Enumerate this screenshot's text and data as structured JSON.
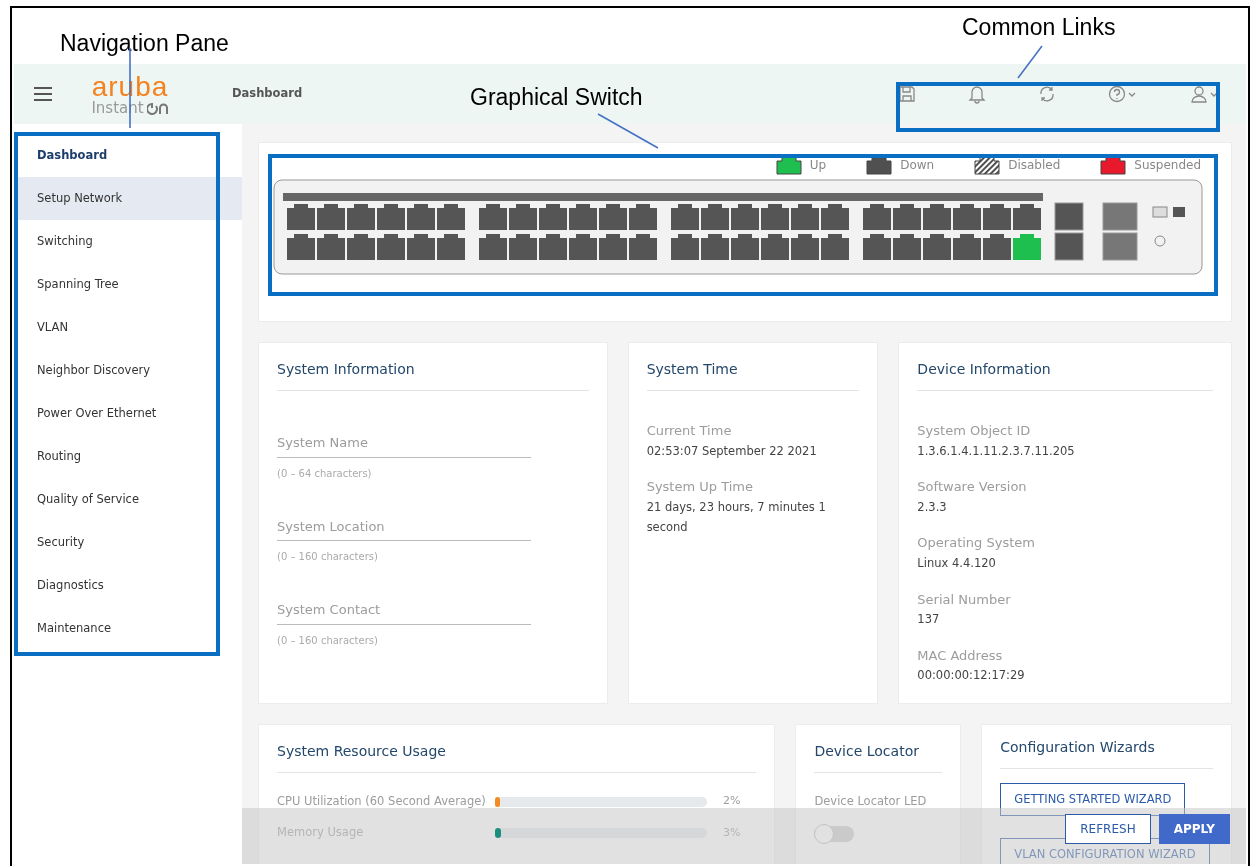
{
  "annotations": [
    {
      "label": "Navigation Pane"
    },
    {
      "label": "Graphical Switch"
    },
    {
      "label": "Common Links"
    }
  ],
  "header": {
    "logo": "aruba",
    "logo_sub": "Instant",
    "page_title": "Dashboard"
  },
  "sidebar": {
    "items": [
      {
        "label": "Dashboard",
        "selected": true,
        "hovered": false
      },
      {
        "label": "Setup Network",
        "selected": false,
        "hovered": true
      },
      {
        "label": "Switching",
        "selected": false,
        "hovered": false
      },
      {
        "label": "Spanning Tree",
        "selected": false,
        "hovered": false
      },
      {
        "label": "VLAN",
        "selected": false,
        "hovered": false
      },
      {
        "label": "Neighbor Discovery",
        "selected": false,
        "hovered": false
      },
      {
        "label": "Power Over Ethernet",
        "selected": false,
        "hovered": false
      },
      {
        "label": "Routing",
        "selected": false,
        "hovered": false
      },
      {
        "label": "Quality of Service",
        "selected": false,
        "hovered": false
      },
      {
        "label": "Security",
        "selected": false,
        "hovered": false
      },
      {
        "label": "Diagnostics",
        "selected": false,
        "hovered": false
      },
      {
        "label": "Maintenance",
        "selected": false,
        "hovered": false
      }
    ]
  },
  "switch": {
    "legend": [
      {
        "label": "Up",
        "kind": "solid",
        "color": "#1fbf4f"
      },
      {
        "label": "Down",
        "kind": "solid",
        "color": "#505050"
      },
      {
        "label": "Disabled",
        "kind": "hatched",
        "color": "#505050"
      },
      {
        "label": "Suspended",
        "kind": "solid",
        "color": "#e8192c"
      }
    ],
    "ports": [
      {
        "up": false
      },
      {
        "up": false
      },
      {
        "up": false
      },
      {
        "up": false
      },
      {
        "up": false
      },
      {
        "up": false
      },
      {
        "up": false
      },
      {
        "up": false
      },
      {
        "up": false
      },
      {
        "up": false
      },
      {
        "up": false
      },
      {
        "up": false
      },
      {
        "up": false
      },
      {
        "up": false
      },
      {
        "up": false
      },
      {
        "up": false
      },
      {
        "up": false
      },
      {
        "up": false
      },
      {
        "up": false
      },
      {
        "up": false
      },
      {
        "up": false
      },
      {
        "up": false
      },
      {
        "up": false
      },
      {
        "up": false
      },
      {
        "up": false
      },
      {
        "up": false
      },
      {
        "up": false
      },
      {
        "up": false
      },
      {
        "up": false
      },
      {
        "up": false
      },
      {
        "up": false
      },
      {
        "up": false
      },
      {
        "up": false
      },
      {
        "up": false
      },
      {
        "up": false
      },
      {
        "up": false
      },
      {
        "up": false
      },
      {
        "up": false
      },
      {
        "up": false
      },
      {
        "up": false
      },
      {
        "up": false
      },
      {
        "up": false
      },
      {
        "up": false
      },
      {
        "up": false
      },
      {
        "up": false
      },
      {
        "up": false
      },
      {
        "up": false
      },
      {
        "up": true
      }
    ]
  },
  "system_information": {
    "title": "System Information",
    "fields": [
      {
        "label": "System Name",
        "hint": "(0 – 64 characters)"
      },
      {
        "label": "System Location",
        "hint": "(0 – 160 characters)"
      },
      {
        "label": "System Contact",
        "hint": "(0 – 160 characters)"
      }
    ]
  },
  "system_time": {
    "title": "System Time",
    "items": [
      {
        "label": "Current Time",
        "value": "02:53:07 September 22 2021"
      },
      {
        "label": "System Up Time",
        "value": "21 days, 23 hours, 7 minutes 1 second"
      }
    ]
  },
  "device_information": {
    "title": "Device Information",
    "items": [
      {
        "label": "System Object ID",
        "value": "1.3.6.1.4.1.11.2.3.7.11.205"
      },
      {
        "label": "Software Version",
        "value": "2.3.3"
      },
      {
        "label": "Operating System",
        "value": "Linux 4.4.120"
      },
      {
        "label": "Serial Number",
        "value": "137"
      },
      {
        "label": "MAC Address",
        "value": "00:00:00:12:17:29"
      }
    ]
  },
  "resource_usage": {
    "title": "System Resource Usage",
    "meters": [
      {
        "label": "CPU Utilization (60 Second Average)",
        "level": 0.02,
        "reading": "2%",
        "color": "#f28b20"
      },
      {
        "label": "Memory Usage",
        "level": 0.03,
        "reading": "3%",
        "color": "#1a8f7f"
      }
    ]
  },
  "device_locator": {
    "title": "Device Locator",
    "label": "Device Locator LED",
    "on": false
  },
  "wizards": {
    "title": "Configuration Wizards",
    "buttons": [
      "GETTING STARTED WIZARD",
      "VLAN CONFIGURATION WIZARD"
    ]
  },
  "footer_buttons": [
    {
      "label": "REFRESH",
      "kind": "outline"
    },
    {
      "label": "APPLY",
      "kind": "primary"
    }
  ]
}
